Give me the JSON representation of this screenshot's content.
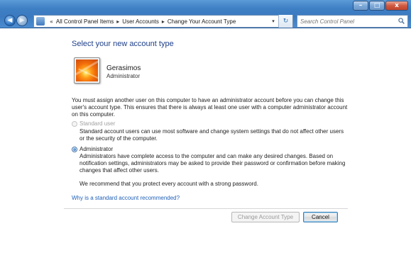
{
  "window": {
    "minimize_glyph": "–",
    "maximize_glyph": "□",
    "close_glyph": "x"
  },
  "nav": {
    "back_icon": "arrow-left-icon",
    "forward_icon": "arrow-right-icon",
    "breadcrumbs": [
      "All Control Panel Items",
      "User Accounts",
      "Change Your Account Type"
    ],
    "separator": "▸",
    "history_separator": "«",
    "dropdown_glyph": "▾",
    "refresh_glyph": "↻"
  },
  "search": {
    "placeholder": "Search Control Panel"
  },
  "main": {
    "title": "Select your new account type",
    "user": {
      "name": "Gerasimos",
      "role": "Administrator"
    },
    "notice": "You must assign another user on this computer to have an administrator account before you can change this user's account type. This ensures that there is always at least one user with a computer administrator account on this computer.",
    "options": [
      {
        "label": "Standard user",
        "description": "Standard account users can use most software and change system settings that do not affect other users or the security of the computer.",
        "checked": false,
        "disabled": true
      },
      {
        "label": "Administrator",
        "description": "Administrators have complete access to the computer and can make any desired changes. Based on notification settings, administrators may be asked to provide their password or confirmation before making changes that affect other users.",
        "checked": true,
        "disabled": false
      }
    ],
    "recommendation": "We recommend that you protect every account with a strong password.",
    "link": "Why is a standard account recommended?",
    "buttons": {
      "change": "Change Account Type",
      "cancel": "Cancel"
    }
  },
  "colors": {
    "title_blue": "#1e3f8a",
    "link_blue": "#1f5fb8",
    "titlebar_blue": "#3f7fc4"
  }
}
